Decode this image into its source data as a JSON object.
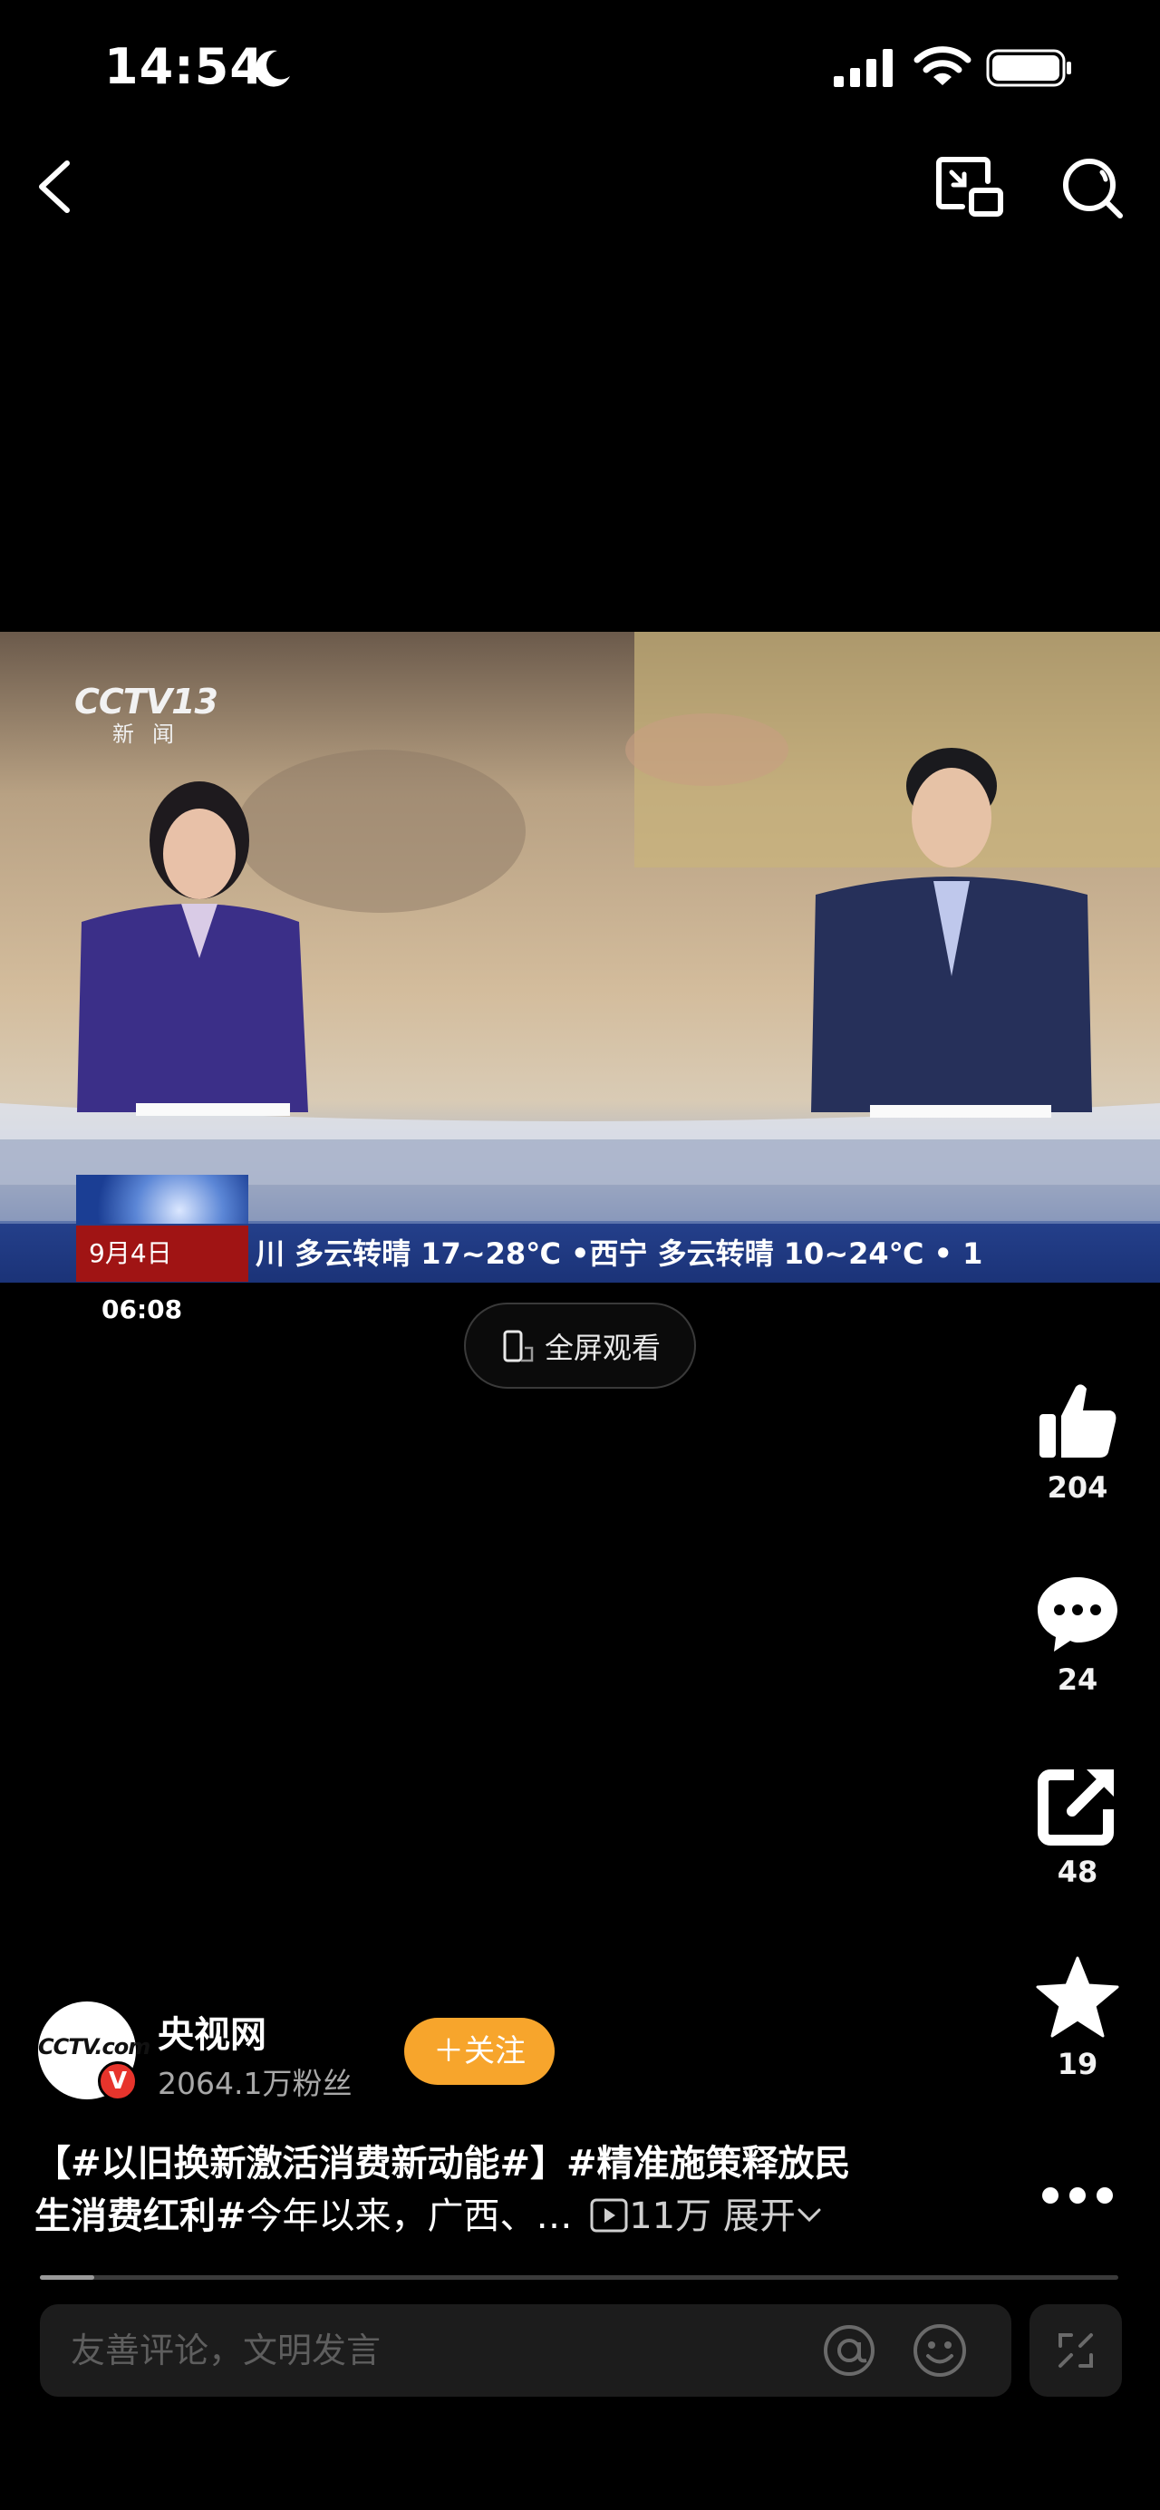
{
  "status_bar": {
    "time": "14:54"
  },
  "video": {
    "channel_logo": "CCTV13",
    "channel_sub": "新闻",
    "ticker_date": "9月4日",
    "ticker_time": "06:08",
    "ticker_text": "川 多云转晴 17~28℃  •西宁 多云转晴 10~24℃  •  1",
    "fullscreen_label": "全屏观看"
  },
  "actions": {
    "like_count": "204",
    "comment_count": "24",
    "share_count": "48",
    "favorite_count": "19"
  },
  "author": {
    "avatar_text": "CCTV.com",
    "verified_mark": "V",
    "name": "央视网",
    "fans": "2064.1万粉丝",
    "follow_label": "＋关注"
  },
  "description": {
    "line1": "【#以旧换新激活消费新动能#】#精准施策释放民",
    "line2_bold": "生消费红利#",
    "line2_rest": "今年以来，广西、…",
    "views": "11万",
    "expand": "展开"
  },
  "progress": {
    "fraction": 0.05
  },
  "comment": {
    "placeholder": "友善评论，文明发言"
  },
  "colors": {
    "accent": "#f7a52c",
    "verified": "#e7342c",
    "background": "#000000"
  },
  "icons": [
    "moon-icon",
    "signal-icon",
    "wifi-icon",
    "battery-icon",
    "back-icon",
    "pip-icon",
    "search-icon",
    "phone-rotate-icon",
    "like-icon",
    "comment-icon",
    "share-icon",
    "favorite-icon",
    "more-icon",
    "play-icon",
    "chevron-down-icon",
    "at-icon",
    "emoji-icon",
    "collapse-icon"
  ]
}
